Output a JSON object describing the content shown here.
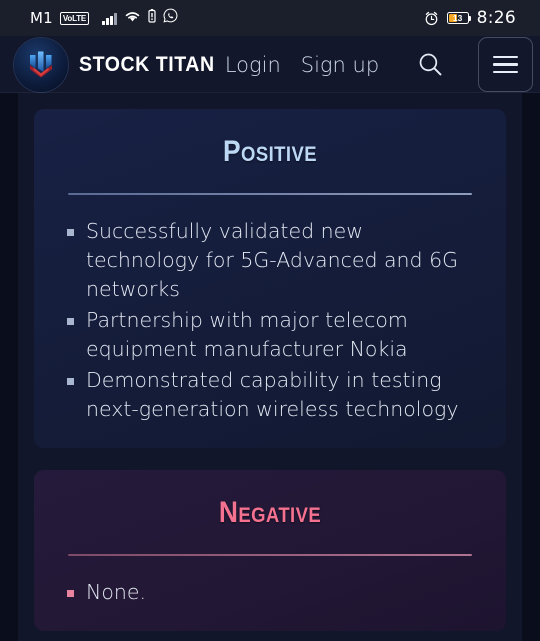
{
  "statusbar": {
    "carrier": "M1",
    "network_badge": "VoLTE",
    "battery_percent": "13",
    "time": "8:26",
    "icons": [
      "signal-bars-icon",
      "wifi-icon",
      "battery-alert-icon",
      "whatsapp-icon",
      "alarm-clock-icon",
      "battery-icon"
    ]
  },
  "header": {
    "brand": "STOCK TITAN",
    "login_label": "Login",
    "signup_label": "Sign up",
    "search_icon": "search-icon",
    "menu_icon": "hamburger-menu-icon",
    "logo_icon": "stock-titan-logo-icon"
  },
  "cards": [
    {
      "id": "positive",
      "title": "Positive",
      "accent": "#bcd8f5",
      "points": [
        "Successfully validated new technology for 5G-Advanced and 6G networks",
        "Partnership with major telecom equipment manufacturer Nokia",
        "Demonstrated capability in testing next-generation wireless technology"
      ]
    },
    {
      "id": "negative",
      "title": "Negative",
      "accent": "#f4728f",
      "points": [
        "None."
      ]
    }
  ]
}
